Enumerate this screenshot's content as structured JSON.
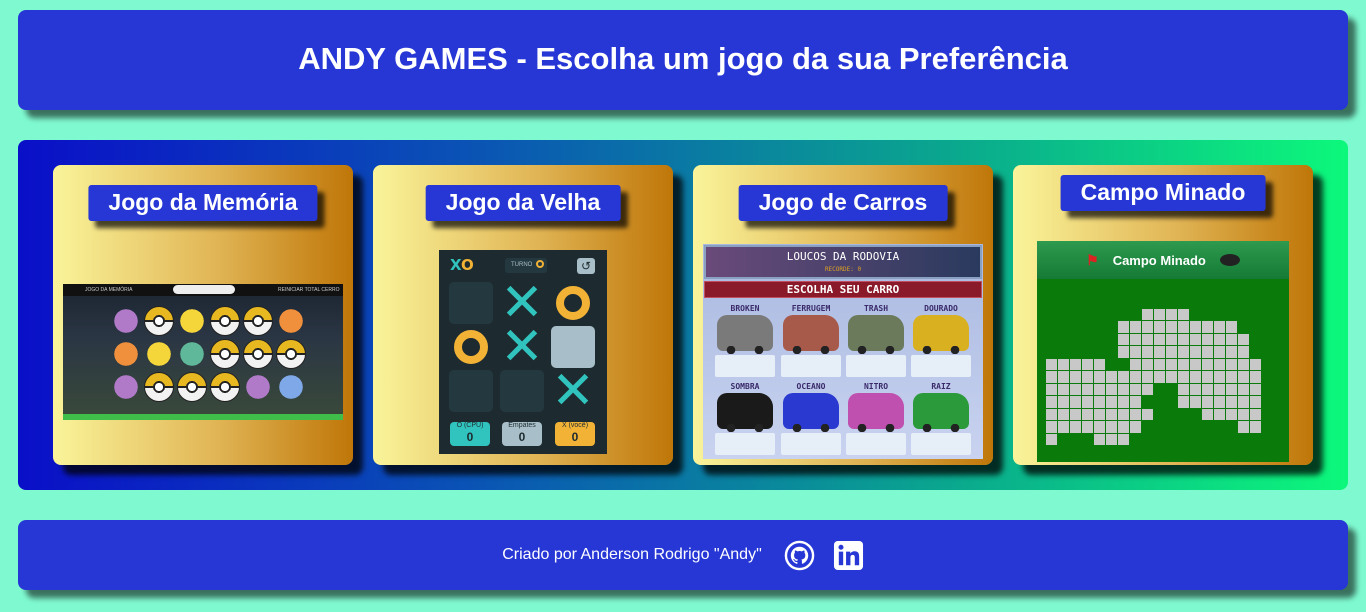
{
  "header": {
    "title": "ANDY GAMES - Escolha um jogo da sua Preferência"
  },
  "games": [
    {
      "title": "Jogo da Memória"
    },
    {
      "title": "Jogo da Velha"
    },
    {
      "title": "Jogo de Carros"
    },
    {
      "title": "Campo Minado"
    }
  ],
  "memory_thumb": {
    "title": "JOGO DA MEMÓRIA",
    "stats": "REINICIAR   TOTAL   CERRO"
  },
  "ttt_thumb": {
    "turn_label": "TURNO",
    "scores": [
      {
        "label": "O (CPU)",
        "value": "0",
        "color": "#31c4be"
      },
      {
        "label": "Empates",
        "value": "0",
        "color": "#a8bfc9"
      },
      {
        "label": "X (você)",
        "value": "0",
        "color": "#f2b236"
      }
    ]
  },
  "cars_thumb": {
    "title": "LOUCOS DA RODOVIA",
    "record": "RECORDE: 0",
    "subtitle": "ESCOLHA SEU CARRO",
    "cars": [
      {
        "name": "BROKEN",
        "color": "#7a7a7a"
      },
      {
        "name": "FERRUGEM",
        "color": "#a85a4a"
      },
      {
        "name": "TRASH",
        "color": "#6a7a5a"
      },
      {
        "name": "DOURADO",
        "color": "#d8b020"
      },
      {
        "name": "SOMBRA",
        "color": "#1a1a1a"
      },
      {
        "name": "OCEANO",
        "color": "#2a3ad0"
      },
      {
        "name": "NITRO",
        "color": "#c050b0"
      },
      {
        "name": "RAIZ",
        "color": "#2a9a3a"
      }
    ]
  },
  "mine_thumb": {
    "title": "Campo Minado"
  },
  "footer": {
    "credit": "Criado por Anderson Rodrigo \"Andy\""
  },
  "icons": {
    "github": "github-icon",
    "linkedin": "linkedin-icon"
  }
}
